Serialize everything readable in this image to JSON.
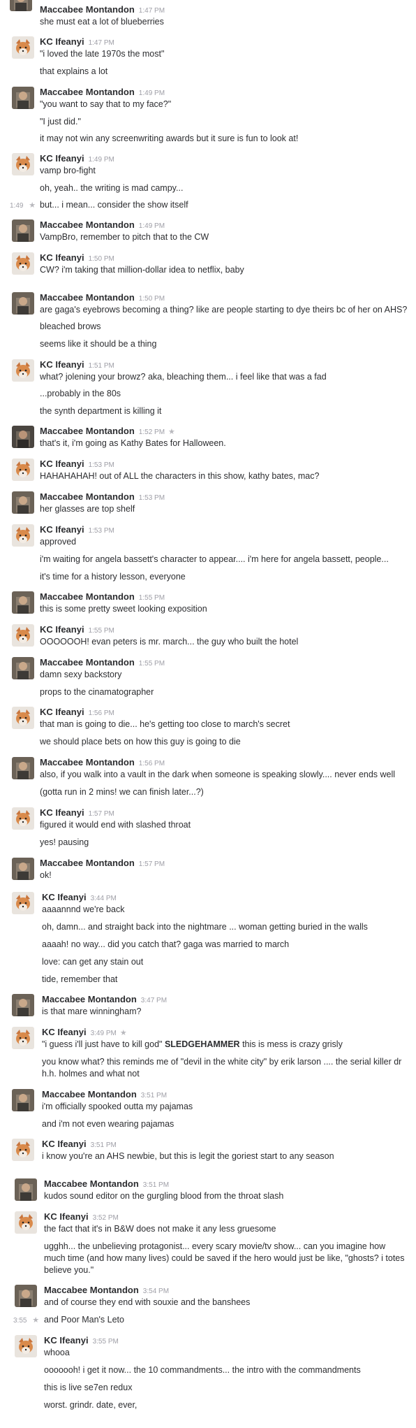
{
  "users": {
    "mm": "Maccabee Montandon",
    "kc": "KC Ifeanyi"
  },
  "colors": {
    "name": "#2c2d30",
    "timestamp": "#9e9ea6",
    "star": "#b8b8bd"
  },
  "icons": {
    "star": "star-icon",
    "avatar_kc": "fox-avatar",
    "avatar_mm": "photo-avatar"
  },
  "messages": [
    {
      "user": "Maccabee Montandon",
      "time": "1:47 PM",
      "lines": [
        "she must eat a lot of blueberries"
      ]
    },
    {
      "user": "KC Ifeanyi",
      "time": "1:47 PM",
      "lines": [
        "\"i loved the late 1970s the most\"",
        "that explains a lot"
      ]
    },
    {
      "user": "Maccabee Montandon",
      "time": "1:49 PM",
      "lines": [
        "\"you want to say that to my face?\"",
        "\"I just did.\"",
        "it may not win any screenwriting awards but it sure is fun to look at!"
      ]
    },
    {
      "user": "KC Ifeanyi",
      "time": "1:49 PM",
      "lines": [
        "vamp bro-fight",
        "oh, yeah.. the writing is mad campy...",
        "but... i mean... consider the show itself"
      ],
      "hover_time": "1:49"
    },
    {
      "user": "Maccabee Montandon",
      "time": "1:49 PM",
      "lines": [
        "VampBro, remember to pitch that to the CW"
      ]
    },
    {
      "user": "KC Ifeanyi",
      "time": "1:50 PM",
      "lines": [
        "CW? i'm taking that million-dollar idea to netflix, baby"
      ]
    },
    {
      "user": "Maccabee Montandon",
      "time": "1:50 PM",
      "lines": [
        "are gaga's eyebrows becoming a thing? like are people starting to dye theirs bc of her on AHS?",
        "bleached brows",
        "seems like it should be a thing"
      ]
    },
    {
      "user": "KC Ifeanyi",
      "time": "1:51 PM",
      "lines": [
        "what? jolening your browz? aka, bleaching them... i feel like that was a fad",
        "...probably in the 80s",
        "the synth department is killing it"
      ]
    },
    {
      "user": "Maccabee Montandon",
      "time": "1:52 PM",
      "lines": [
        "that's it, i'm going as Kathy Bates for Halloween."
      ],
      "starred": true
    },
    {
      "user": "KC Ifeanyi",
      "time": "1:53 PM",
      "lines": [
        "HAHAHAHAH! out of ALL the characters in this show, kathy bates, mac?"
      ]
    },
    {
      "user": "Maccabee Montandon",
      "time": "1:53 PM",
      "lines": [
        "her glasses are top shelf"
      ]
    },
    {
      "user": "KC Ifeanyi",
      "time": "1:53 PM",
      "lines": [
        "approved",
        "i'm waiting for angela bassett's character to appear.... i'm here for angela bassett, people...",
        "it's time for a history lesson, everyone"
      ]
    },
    {
      "user": "Maccabee Montandon",
      "time": "1:55 PM",
      "lines": [
        "this is some pretty sweet looking exposition"
      ]
    },
    {
      "user": "KC Ifeanyi",
      "time": "1:55 PM",
      "lines": [
        "OOOOOOH! evan peters is mr. march... the guy who built the hotel"
      ]
    },
    {
      "user": "Maccabee Montandon",
      "time": "1:55 PM",
      "lines": [
        "damn sexy backstory",
        "props to the cinamatographer"
      ]
    },
    {
      "user": "KC Ifeanyi",
      "time": "1:56 PM",
      "lines": [
        "that man is going to die... he's getting too close to march's secret",
        "we should place bets on how this guy is going to die"
      ]
    },
    {
      "user": "Maccabee Montandon",
      "time": "1:56 PM",
      "lines": [
        "also, if you walk into a vault in the dark when someone is speaking slowly.... never ends well",
        "(gotta run in 2 mins! we can finish later...?)"
      ]
    },
    {
      "user": "KC Ifeanyi",
      "time": "1:57 PM",
      "lines": [
        "figured it would end with slashed throat",
        "yes! pausing"
      ]
    },
    {
      "user": "Maccabee Montandon",
      "time": "1:57 PM",
      "lines": [
        "ok!"
      ]
    },
    {
      "user": "KC Ifeanyi",
      "time": "3:44 PM",
      "lines": [
        "aaaannnd we're back",
        "oh, damn... and straight back into the nightmare ... woman getting buried in the walls",
        "aaaah! no way... did you catch that? gaga was married to march",
        "love: can get any stain out",
        "tide, remember that"
      ]
    },
    {
      "user": "Maccabee Montandon",
      "time": "3:47 PM",
      "lines": [
        "is that mare winningham?"
      ]
    },
    {
      "user": "KC Ifeanyi",
      "time": "3:49 PM",
      "starred": true,
      "lines": [
        "\"i guess i'll just have to kill god\" ",
        "you know what? this reminds me of \"devil in the white city\" by erik larson .... the serial killer dr h.h. holmes and what not"
      ],
      "bold": "SLEDGEHAMMER",
      "after_bold": "  this is mess is crazy grisly"
    },
    {
      "user": "Maccabee Montandon",
      "time": "3:51 PM",
      "lines": [
        "i'm officially spooked outta my pajamas",
        "and i'm not even wearing pajamas"
      ]
    },
    {
      "user": "KC Ifeanyi",
      "time": "3:51 PM",
      "lines": [
        "i know you're an AHS newbie, but this is legit the goriest start to any season"
      ]
    },
    {
      "user": "Maccabee Montandon",
      "time": "3:51 PM",
      "lines": [
        "kudos sound editor on the gurgling blood from the throat slash"
      ]
    },
    {
      "user": "KC Ifeanyi",
      "time": "3:52 PM",
      "lines": [
        "the fact that it's in B&W does not make it any less gruesome",
        "ugghh... the unbelieving protagonist... every scary movie/tv show... can you imagine how much time (and how many lives) could be saved if the hero would just be like, \"ghosts? i totes believe you.\""
      ]
    },
    {
      "user": "Maccabee Montandon",
      "time": "3:54 PM",
      "lines": [
        "and of course they end with souxie and the banshees",
        "and Poor Man's Leto"
      ],
      "hover_time": "3:55"
    },
    {
      "user": "KC Ifeanyi",
      "time": "3:55 PM",
      "lines": [
        "whooa",
        "ooooooh! i get it now... the 10 commandments... the intro with the commandments",
        "this is live se7en redux",
        "worst. grindr. date, ever,"
      ]
    }
  ]
}
